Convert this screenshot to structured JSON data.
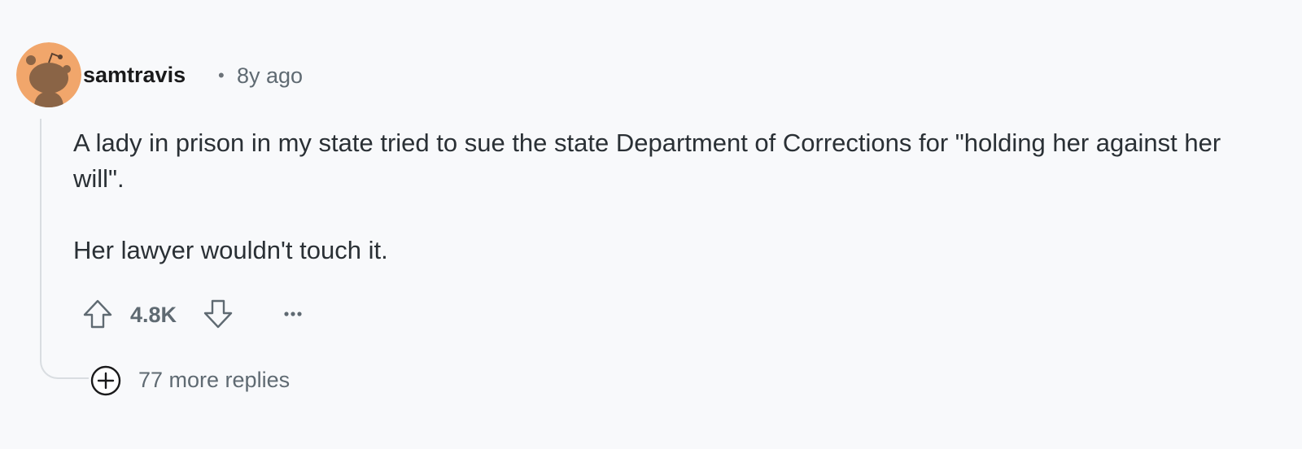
{
  "comment": {
    "author": "samtravis",
    "separator": "•",
    "timestamp": "8y ago",
    "avatar_icon": "snoo-avatar-icon",
    "paragraphs": [
      "A lady in prison in my state tried to sue the state Department of Corrections for \"holding her against her will\".",
      "Her lawyer wouldn't touch it."
    ],
    "score": "4.8K",
    "more_replies": "77 more replies"
  },
  "icons": {
    "upvote": "upvote-arrow-icon",
    "downvote": "downvote-arrow-icon",
    "more": "ellipsis-icon",
    "expand": "plus-circle-icon"
  },
  "colors": {
    "background": "#f8f9fb",
    "avatar_bg": "#f1a66b",
    "text": "#2a3035",
    "muted": "#5f6a72",
    "thread_line": "#d9dde1"
  }
}
